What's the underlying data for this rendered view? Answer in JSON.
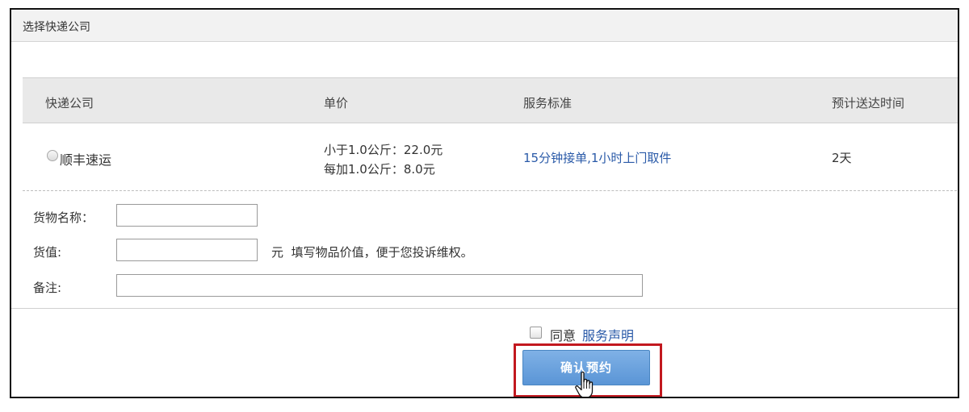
{
  "panel": {
    "title": "选择快递公司"
  },
  "table": {
    "headers": [
      "快递公司",
      "单价",
      "服务标准",
      "预计送达时间"
    ],
    "rows": [
      {
        "company": "顺丰速运",
        "price_lines": [
          "小于1.0公斤：22.0元",
          "每加1.0公斤：8.0元"
        ],
        "service": "15分钟接单,1小时上门取件",
        "eta": "2天",
        "selected": false
      }
    ]
  },
  "form": {
    "goods_name_label": "货物名称：",
    "goods_name_value": "",
    "goods_value_label": "货值:",
    "goods_value_value": "",
    "goods_value_unit": "元",
    "goods_value_hint": "填写物品价值，便于您投诉维权。",
    "note_label": "备注:",
    "note_value": ""
  },
  "agreement": {
    "checked": false,
    "text": "同意",
    "link": "服务声明"
  },
  "confirm_button": {
    "label": "确认预约"
  },
  "colors": {
    "link": "#2a5aa8",
    "button": "#5a95d6",
    "highlight": "#c2181f"
  },
  "icons": {
    "cursor": "hand-pointer-icon"
  }
}
